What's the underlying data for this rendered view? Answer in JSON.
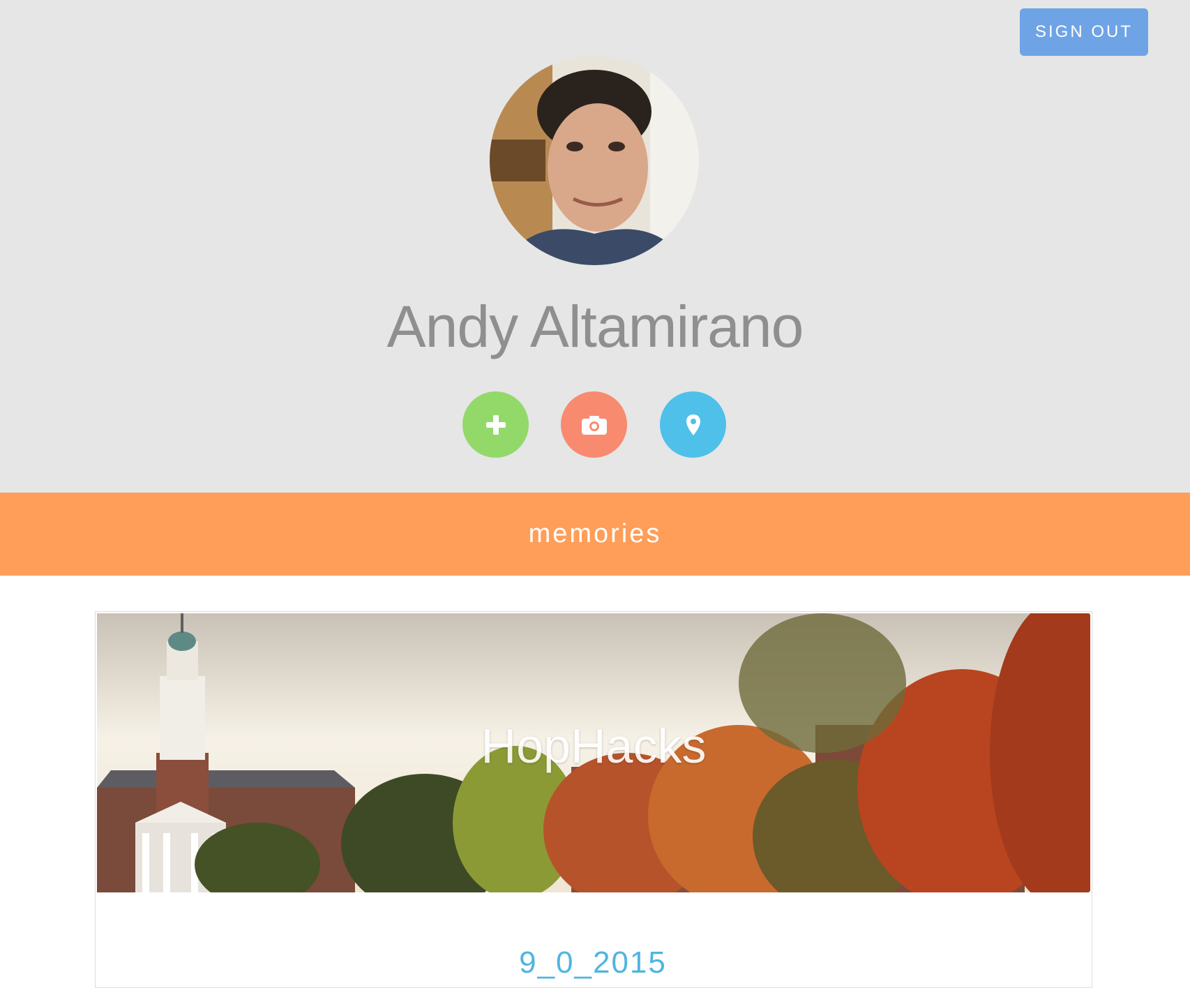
{
  "header": {
    "sign_out_label": "SIGN OUT",
    "user_name": "Andy Altamirano"
  },
  "actions": [
    {
      "name": "add",
      "icon": "plus-icon",
      "color": "#92d96a"
    },
    {
      "name": "camera",
      "icon": "camera-icon",
      "color": "#f88a6f"
    },
    {
      "name": "location",
      "icon": "map-pin-icon",
      "color": "#4ec0ea"
    }
  ],
  "banner": {
    "label": "memories",
    "color": "#ff9e59"
  },
  "memories": [
    {
      "title": "HopHacks",
      "date": "9_0_2015"
    }
  ],
  "colors": {
    "header_bg": "#e6e6e6",
    "sign_out_bg": "#6ea3e6",
    "date_color": "#4fb5e0"
  }
}
